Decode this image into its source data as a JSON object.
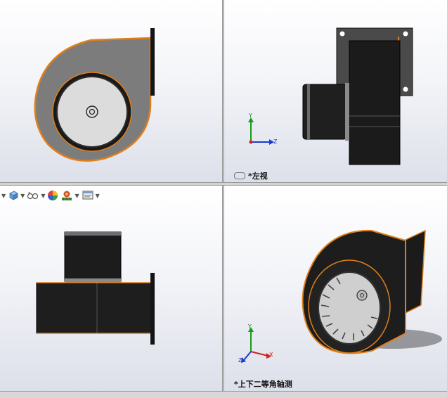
{
  "viewports": {
    "top_left": {
      "label": ""
    },
    "top_right": {
      "label": "*左视"
    },
    "bottom_left": {
      "label": ""
    },
    "bottom_right": {
      "label": "*上下二等角轴测"
    }
  },
  "triad": {
    "y": "Y",
    "z": "Z",
    "x": "X"
  },
  "toolbar": {
    "items": [
      {
        "icon": "view-orientation-icon"
      },
      {
        "icon": "display-style-cube-icon"
      },
      {
        "icon": "hide-show-items-icon"
      },
      {
        "icon": "edit-appearance-icon"
      },
      {
        "icon": "apply-scene-icon"
      },
      {
        "icon": "view-settings-icon"
      }
    ]
  },
  "colors": {
    "accent_edge": "#e07f1a",
    "body_dark": "#1b1b1b",
    "housing_gray": "#7d7d7d",
    "axis_y": "#1a9a1a",
    "axis_z": "#1a3ad0",
    "axis_x": "#d02020"
  }
}
